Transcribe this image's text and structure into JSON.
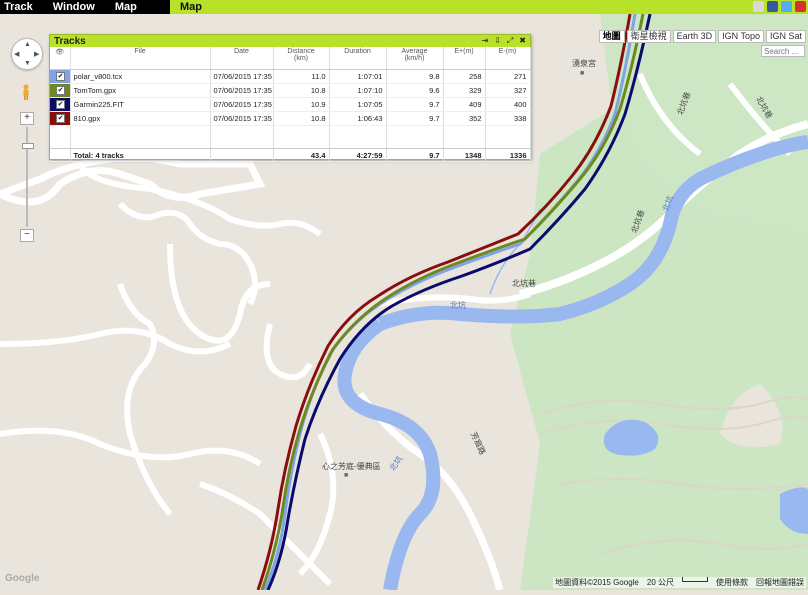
{
  "menu": {
    "items": [
      "Track",
      "Window",
      "Map"
    ]
  },
  "active_tab": "Map",
  "top_icons": [
    {
      "name": "window-icon",
      "color": "#d8d8d8"
    },
    {
      "name": "facebook-icon",
      "color": "#3b5998"
    },
    {
      "name": "twitter-icon",
      "color": "#55acee"
    },
    {
      "name": "youtube-icon",
      "color": "#d9302c"
    }
  ],
  "map_types": [
    "地圖",
    "衛星檢視",
    "Earth 3D",
    "IGN Topo",
    "IGN Sat"
  ],
  "map_type_active": "地圖",
  "search": {
    "placeholder": "Search ..."
  },
  "zoom": {
    "plus": "+",
    "minus": "−"
  },
  "tracks_panel": {
    "title": "Tracks",
    "columns": [
      "File",
      "Date",
      "Distance\n(km)",
      "Duration",
      "Average\n(km/h)",
      "E+(m)",
      "E-(m)"
    ],
    "rows": [
      {
        "color": "#7fa3e8",
        "file": "polar_v800.tcx",
        "date": "07/06/2015 17:35",
        "distance": "11.0",
        "duration": "1:07:01",
        "average": "9.8",
        "eplus": "258",
        "eminus": "271"
      },
      {
        "color": "#6e8a1e",
        "file": "TomTom.gpx",
        "date": "07/06/2015 17:35",
        "distance": "10.8",
        "duration": "1:07:10",
        "average": "9.6",
        "eplus": "329",
        "eminus": "327"
      },
      {
        "color": "#0b0b6e",
        "file": "Garmin225.FIT",
        "date": "07/06/2015 17:35",
        "distance": "10.9",
        "duration": "1:07:05",
        "average": "9.7",
        "eplus": "409",
        "eminus": "400"
      },
      {
        "color": "#8b0e0e",
        "file": "810.gpx",
        "date": "07/06/2015 17:35",
        "distance": "10.8",
        "duration": "1:06:43",
        "average": "9.7",
        "eplus": "352",
        "eminus": "338"
      }
    ],
    "total": {
      "label": "Total: 4 tracks",
      "distance": "43.4",
      "duration": "4:27:59",
      "average": "9.7",
      "eplus": "1348",
      "eminus": "1336"
    }
  },
  "map_labels": {
    "temple": "湧泉宮",
    "road1": "北坑巷",
    "road2": "北坑巷",
    "road3": "北坑巷",
    "river1": "北坑",
    "river2": "北坑",
    "river3": "北坑",
    "road4": "芳窩路",
    "poi": "心之芳庭-優典區",
    "road5": "北坑巷"
  },
  "footer": {
    "attribution": "地圖資料©2015 Google",
    "scale": "20 公尺",
    "terms": "使用條款",
    "report": "回報地圖錯誤"
  },
  "google_logo": "Google"
}
